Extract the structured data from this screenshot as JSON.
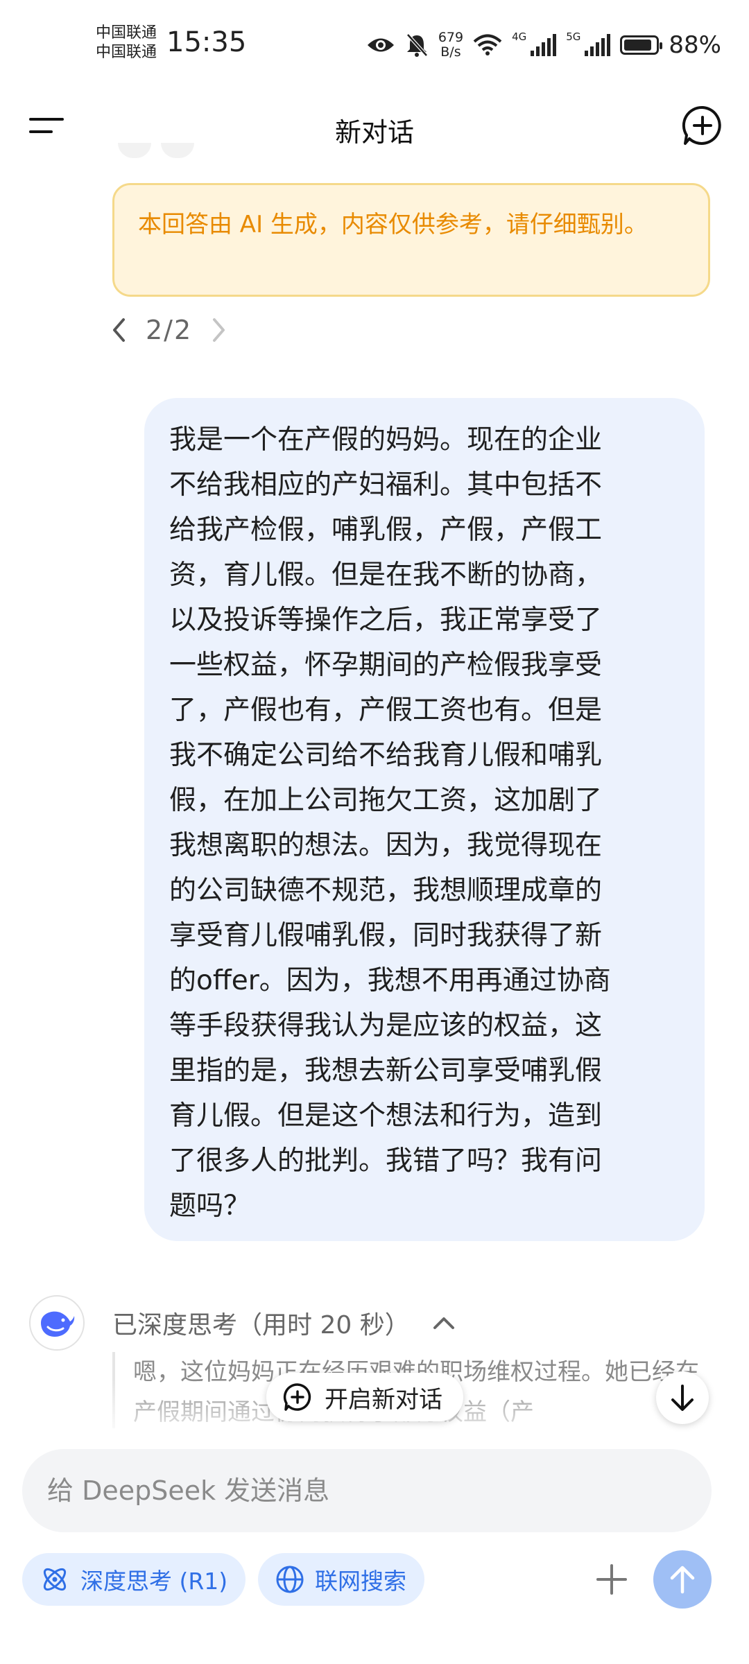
{
  "status_bar": {
    "carrier_1": "中国联通",
    "carrier_2": "中国联通",
    "time": "15:35",
    "net_speed_value": "679",
    "net_speed_unit": "B/s",
    "net_type_1": "4G",
    "net_type_2": "5G",
    "battery_level": 0.88,
    "battery_percent": "88%",
    "icons": [
      "eye-icon",
      "bell-muted-icon",
      "wifi-icon",
      "signal-icon",
      "battery-icon"
    ]
  },
  "header": {
    "title": "新对话",
    "icons": [
      "menu-icon",
      "new-chat-icon"
    ]
  },
  "notice": {
    "text": "本回答由 AI 生成，内容仅供参考，请仔细甄别。"
  },
  "pager": {
    "text": "2/2",
    "icons": [
      "chevron-left-icon",
      "chevron-right-icon"
    ]
  },
  "user_message": {
    "text": "我是一个在产假的妈妈。现在的企业\n不给我相应的产妇福利。其中包括不\n给我产检假，哺乳假，产假，产假工\n资，育儿假。但是在我不断的协商，\n以及投诉等操作之后，我正常享受了\n一些权益，怀孕期间的产检假我享受\n了，产假也有，产假工资也有。但是\n我不确定公司给不给我育儿假和哺乳\n假，在加上公司拖欠工资，这加剧了\n我想离职的想法。因为，我觉得现在\n的公司缺德不规范，我想顺理成章的\n享受育儿假哺乳假，同时我获得了新\n的offer。因为，我想不用再通过协商\n等手段获得我认为是应该的权益，这\n里指的是，我想去新公司享受哺乳假\n育儿假。但是这个想法和行为，造到\n了很多人的批判。我错了吗？我有问\n题吗？"
  },
  "assistant": {
    "thinking_label": "已深度思考（用时 20 秒）",
    "thinking_text": "嗯，这位妈妈正在经历艰难的职场维权过程。她已经在产假期间通过协商获得了部分权益（产",
    "icons": [
      "deepseek-whale-icon",
      "chevron-up-icon"
    ]
  },
  "floating": {
    "new_conversation_label": "开启新对话",
    "icons": [
      "plus-circle-icon",
      "arrow-down-icon"
    ]
  },
  "composer": {
    "placeholder": "给 DeepSeek 发送消息",
    "value": "",
    "deep_think_label": "深度思考 (R1)",
    "web_search_label": "联网搜索",
    "accent_color": "#2f6fe6",
    "icons": [
      "atom-icon",
      "globe-icon",
      "plus-icon",
      "arrow-up-icon"
    ]
  }
}
